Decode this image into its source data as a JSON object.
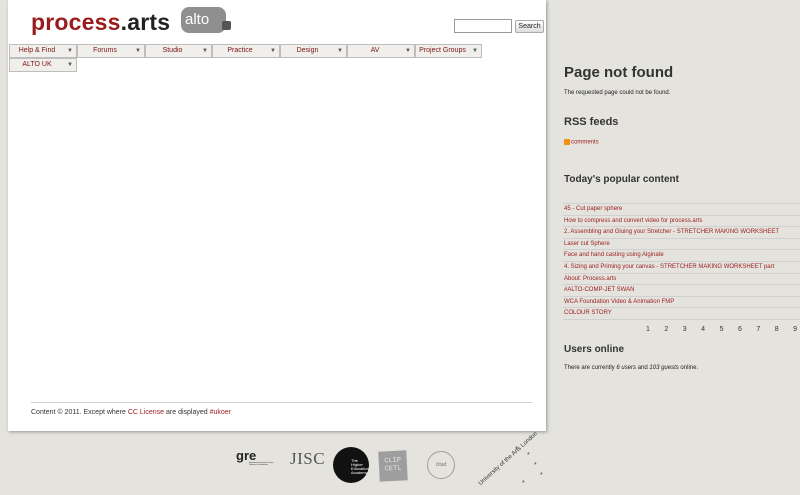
{
  "header": {
    "logo_part1": "process",
    "logo_part2": ".arts",
    "badge": "alto",
    "search_button": "Search"
  },
  "nav": {
    "items": [
      {
        "label": "Help & Find"
      },
      {
        "label": "Forums"
      },
      {
        "label": "Studio"
      },
      {
        "label": "Practice"
      },
      {
        "label": "Design"
      },
      {
        "label": "AV"
      },
      {
        "label": "Project Groups"
      },
      {
        "label": "ALTO UK"
      }
    ],
    "arrow": "▼"
  },
  "footer": {
    "prefix": "Content © 2011. Except where ",
    "link1": "CC License",
    "middle": " are displayed ",
    "link2": "#ukoer"
  },
  "sidebar": {
    "not_found_title": "Page not found",
    "not_found_text": "The requested page could not be found.",
    "rss_title": "RSS feeds",
    "rss_link": "comments",
    "popular_title": "Today's popular content",
    "popular_items": [
      "45 - Cut paper sphere",
      "How to compress and convert video for process.arts",
      "2. Assembling and Gluing your Stretcher - STRETCHER MAKING WORKSHEET",
      "Laser cut Sphere",
      "Face and hand casting using Alginate",
      "4. Sizing and Priming your canvas - STRETCHER MAKING WORKSHEET part",
      "About: Process.arts",
      "#ALTO-COMP-JET SWAN",
      "WCA Foundation Video & Animation FMP",
      "COLOUR STORY"
    ],
    "pager": [
      "1",
      "2",
      "3",
      "4",
      "5",
      "6",
      "7",
      "8",
      "9"
    ],
    "users_title": "Users online",
    "users_prefix": "There are currently ",
    "users_count": "6 users",
    "users_middle": " and ",
    "guests_count": "103 guests",
    "users_suffix": " online."
  },
  "partners": {
    "gre": "gre",
    "gre_sub": "Greenwich Centre for Open Resource Production",
    "jisc": "JISC",
    "hea": "The Higher Education Academy",
    "clip": "CLIP CETL",
    "cltad": "cltad",
    "ual": "University of the Arts London"
  },
  "colors": {
    "brand_red": "#9b1c1c",
    "background": "#e4e3de",
    "rss_orange": "#f29111"
  }
}
